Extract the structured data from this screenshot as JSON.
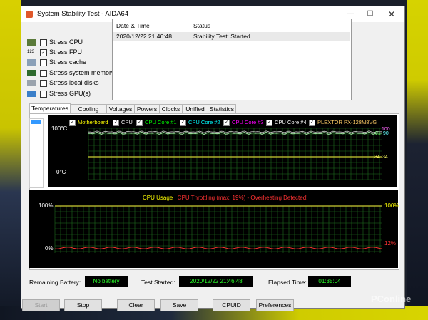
{
  "window": {
    "title": "System Stability Test - AIDA64"
  },
  "stress_options": [
    {
      "label": "Stress CPU",
      "checked": false,
      "icon": "cpu-icon"
    },
    {
      "label": "Stress FPU",
      "checked": true,
      "icon": "fpu-icon"
    },
    {
      "label": "Stress cache",
      "checked": false,
      "icon": "cache-icon"
    },
    {
      "label": "Stress system memory",
      "checked": false,
      "icon": "memory-icon"
    },
    {
      "label": "Stress local disks",
      "checked": false,
      "icon": "disk-icon"
    },
    {
      "label": "Stress GPU(s)",
      "checked": false,
      "icon": "gpu-icon"
    }
  ],
  "log": {
    "columns": [
      "Date & Time",
      "Status"
    ],
    "rows": [
      {
        "datetime": "2020/12/22 21:46:48",
        "status": "Stability Test: Started"
      }
    ]
  },
  "tabs": [
    "Temperatures",
    "Cooling Fans",
    "Voltages",
    "Powers",
    "Clocks",
    "Unified",
    "Statistics"
  ],
  "active_tab": "Temperatures",
  "temp_graph": {
    "legend": [
      {
        "label": "Motherboard",
        "color": "#ffff00",
        "checked": true
      },
      {
        "label": "CPU",
        "color": "#ffffff",
        "checked": true
      },
      {
        "label": "CPU Core #1",
        "color": "#00ff00",
        "checked": true
      },
      {
        "label": "CPU Core #2",
        "color": "#00ffff",
        "checked": true
      },
      {
        "label": "CPU Core #3",
        "color": "#ff00ff",
        "checked": true
      },
      {
        "label": "CPU Core #4",
        "color": "#ffffff",
        "checked": true
      },
      {
        "label": "PLEXTOR PX-128M8VG",
        "color": "#ffcc66",
        "checked": true
      }
    ],
    "y_top": "100°C",
    "y_bottom": "0°C",
    "right_vals": {
      "v100": "100",
      "v91": "91",
      "v90": "90",
      "v34a": "34",
      "v34b": "34"
    }
  },
  "cpu_graph": {
    "title_usage": "CPU Usage",
    "separator": "|",
    "title_throttle": "CPU Throttling (max: 19%) - Overheating Detected!",
    "y_top_left": "100%",
    "y_bottom_left": "0%",
    "y_top_right": "100%",
    "y_bottom_right": "12%"
  },
  "status": {
    "battery_label": "Remaining Battery:",
    "battery_value": "No battery",
    "started_label": "Test Started:",
    "started_value": "2020/12/22 21:46:48",
    "elapsed_label": "Elapsed Time:",
    "elapsed_value": "01:35:04"
  },
  "buttons": {
    "start": "Start",
    "stop": "Stop",
    "clear": "Clear",
    "save": "Save",
    "cpuid": "CPUID",
    "preferences": "Preferences"
  },
  "watermark": "PConline"
}
